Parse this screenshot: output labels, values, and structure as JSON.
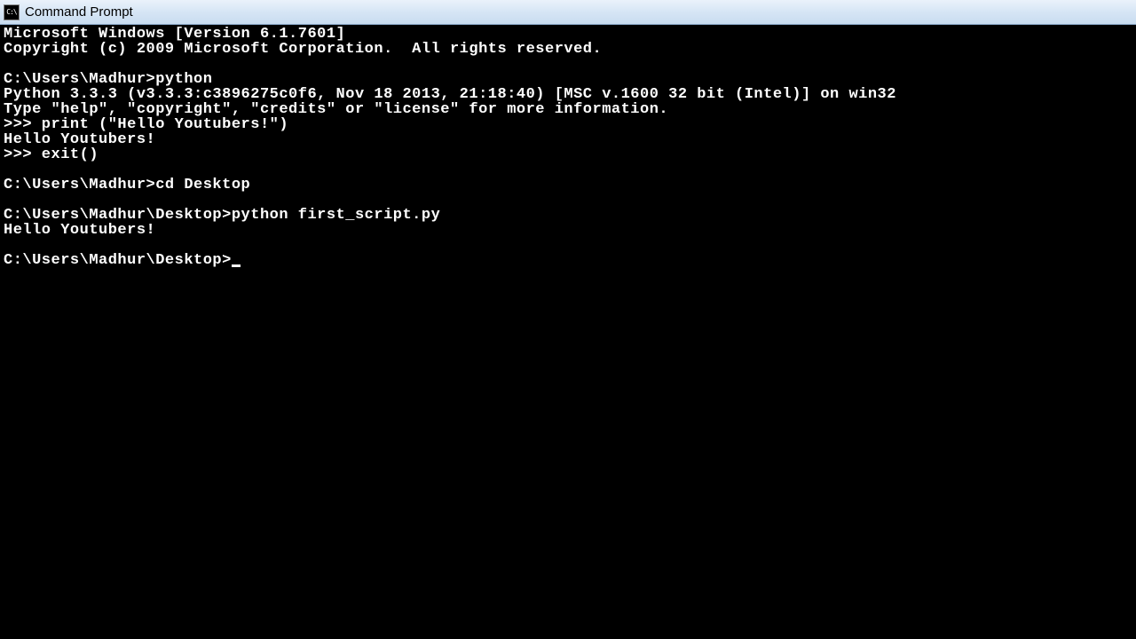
{
  "window": {
    "title": "Command Prompt",
    "icon_label": "C:\\"
  },
  "terminal": {
    "lines": [
      "Microsoft Windows [Version 6.1.7601]",
      "Copyright (c) 2009 Microsoft Corporation.  All rights reserved.",
      "",
      "C:\\Users\\Madhur>python",
      "Python 3.3.3 (v3.3.3:c3896275c0f6, Nov 18 2013, 21:18:40) [MSC v.1600 32 bit (Intel)] on win32",
      "Type \"help\", \"copyright\", \"credits\" or \"license\" for more information.",
      ">>> print (\"Hello Youtubers!\")",
      "Hello Youtubers!",
      ">>> exit()",
      "",
      "C:\\Users\\Madhur>cd Desktop",
      "",
      "C:\\Users\\Madhur\\Desktop>python first_script.py",
      "Hello Youtubers!",
      "",
      "C:\\Users\\Madhur\\Desktop>"
    ],
    "cursor_visible": true
  }
}
